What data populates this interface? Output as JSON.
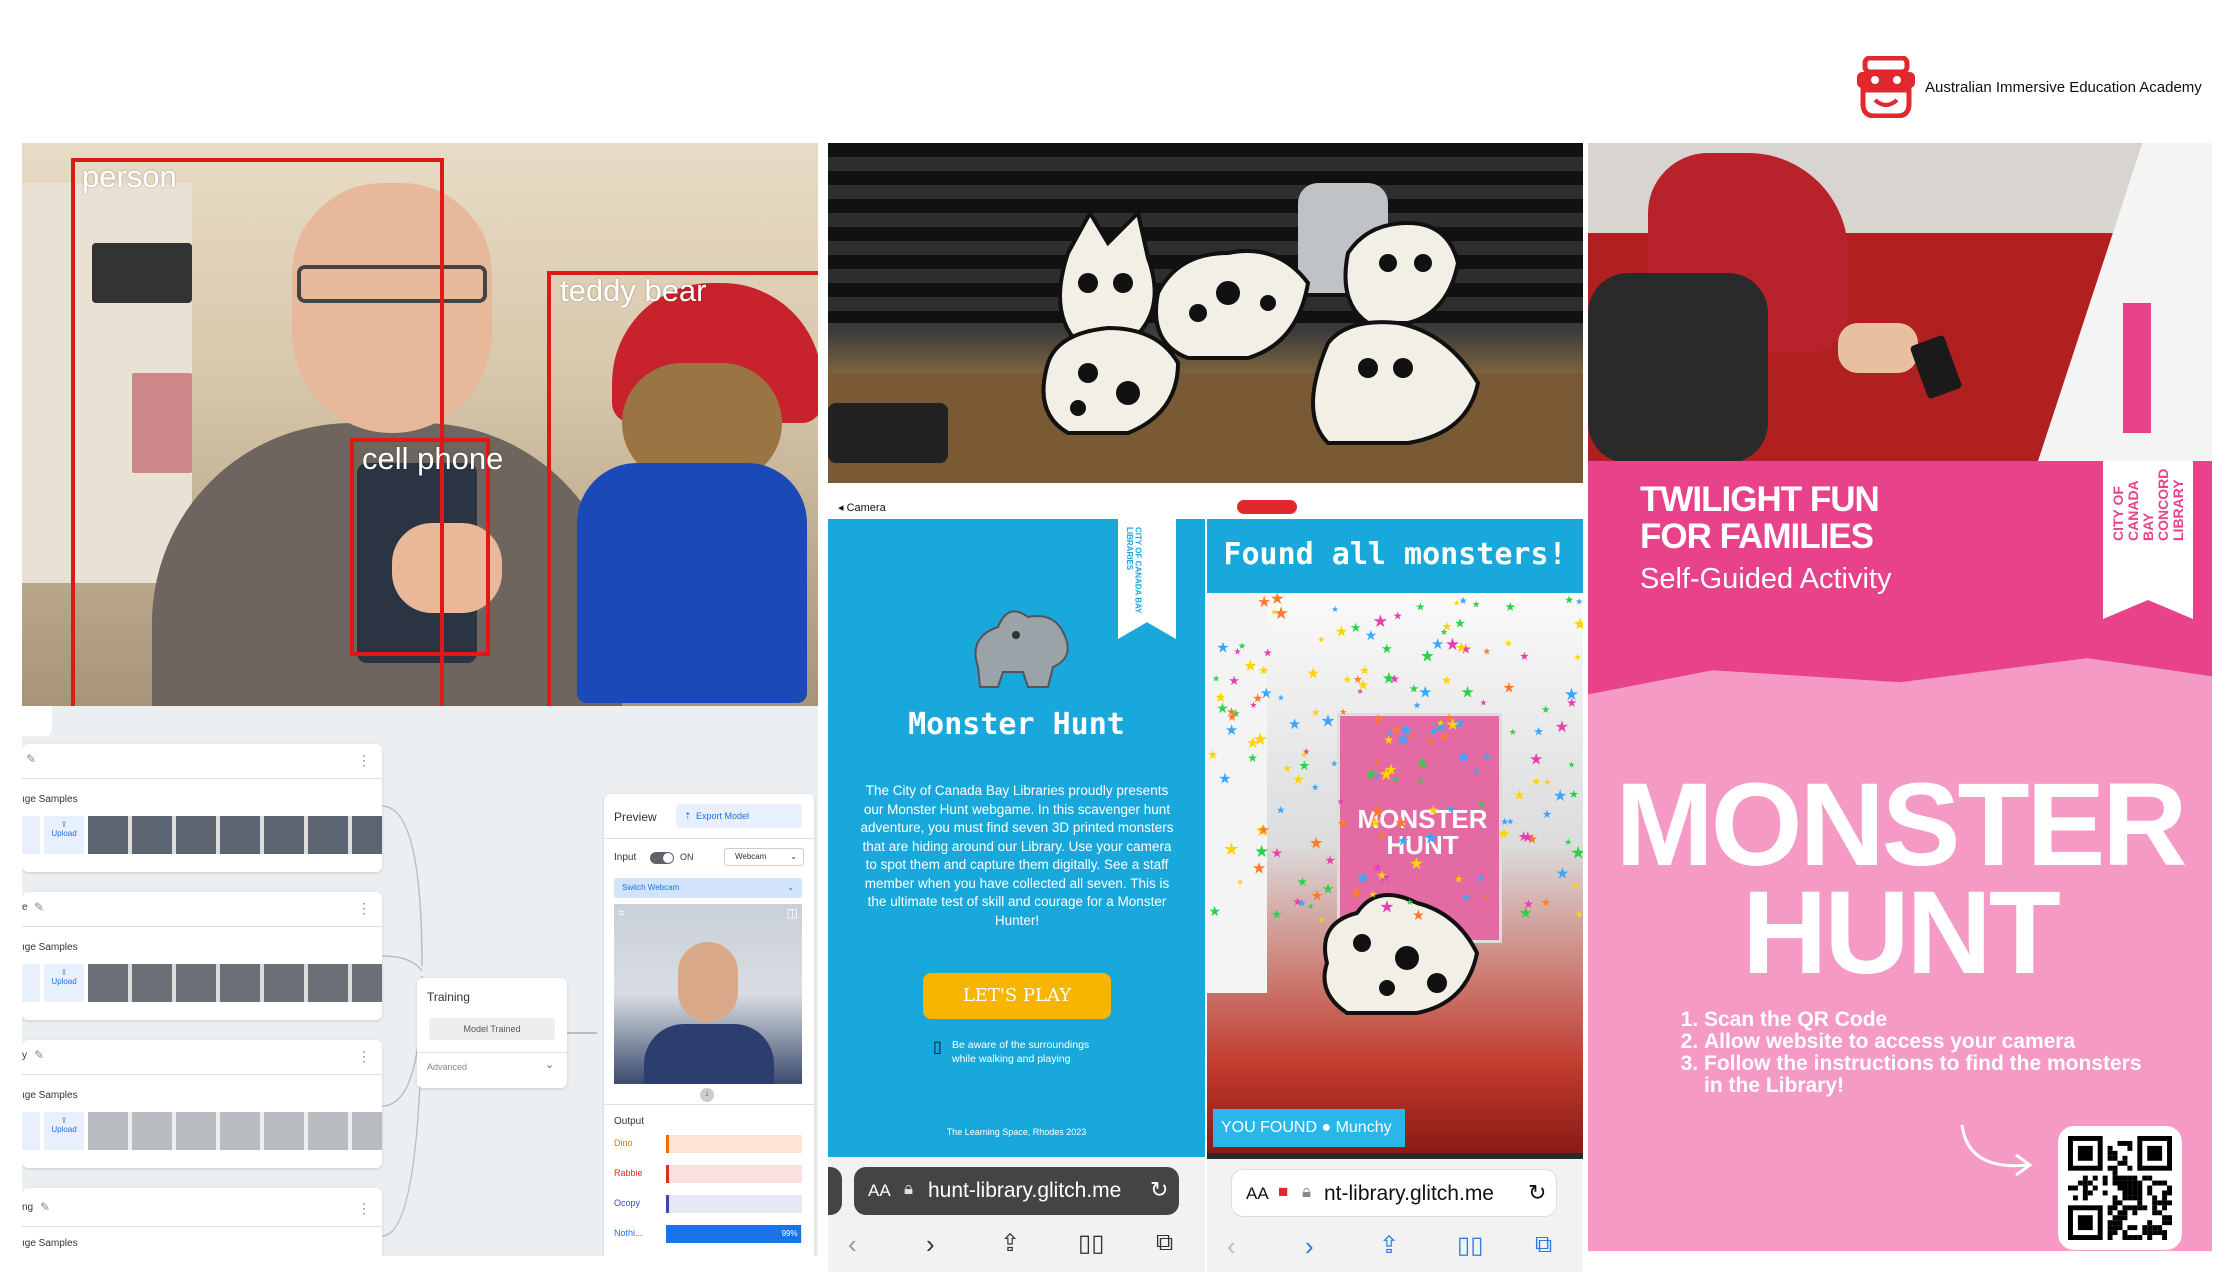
{
  "header": {
    "logo_text": "Australian Immersive Education Academy"
  },
  "detection": {
    "labels": {
      "person": "person",
      "teddy": "teddy bear",
      "phone": "cell phone"
    }
  },
  "tm": {
    "samples_label": "ıge Samples",
    "classes": [
      {
        "name": ""
      },
      {
        "name": "e"
      },
      {
        "name": "y"
      },
      {
        "name": "ng"
      }
    ],
    "upload_label": "Upload",
    "webcam_short": "m",
    "training_title": "Training",
    "model_trained": "Model Trained",
    "advanced": "Advanced",
    "preview_title": "Preview",
    "export_model": "Export Model",
    "input_label": "Input",
    "on_label": "ON",
    "webcam_select": "Webcam",
    "switch_webcam": "Switch Webcam",
    "output_label": "Output",
    "outputs": [
      {
        "name": "Dino",
        "pct": 0.0
      },
      {
        "name": "Rabbie",
        "pct": 0.01
      },
      {
        "name": "Ocopy",
        "pct": 0.0
      },
      {
        "name": "Nothi...",
        "pct": 0.99,
        "pct_label": "99%"
      }
    ]
  },
  "phone1": {
    "status_back": "◂ Camera",
    "ribbon": "CITY OF CANADA BAY LIBRARIES",
    "title": "Monster Hunt",
    "body": "The City of Canada Bay Libraries proudly presents our Monster Hunt webgame. In this scavenger hunt adventure, you must find seven 3D printed monsters that are hiding around our Library. Use your camera to spot them and capture them digitally. See a staff member when you have collected all seven. This is the ultimate test of skill and courage for a Monster Hunter!",
    "play_button": "LET'S PLAY",
    "safety_line1": "Be aware of the surroundings",
    "safety_line2": "while walking and playing",
    "footer": "The Learning Space, Rhodes 2023",
    "url": "hunt-library.glitch.me",
    "aa": "AA"
  },
  "phone2": {
    "banner": "Found all monsters!",
    "found_prefix": "YOU FOUND",
    "found_name": "Munchy",
    "poster_title": "MONSTER HUNT",
    "url": "nt-library.glitch.me",
    "aa": "AA"
  },
  "poster": {
    "headline1": "TWILIGHT FUN",
    "headline2": "FOR FAMILIES",
    "subhead": "Self-Guided Activity",
    "ribbon": "CITY OF CANADA BAY CONCORD LIBRARY",
    "title1": "MONSTER",
    "title2": "HUNT",
    "steps": [
      "Scan the QR Code",
      "Allow website to access your camera",
      "Follow the instructions to find the monsters in the Library!"
    ]
  },
  "colors": {
    "detect_red": "#e01818",
    "tm_blue": "#1a73e8",
    "cyan": "#18a8dc",
    "pink": "#e8428a",
    "orange": "#f7b500"
  }
}
